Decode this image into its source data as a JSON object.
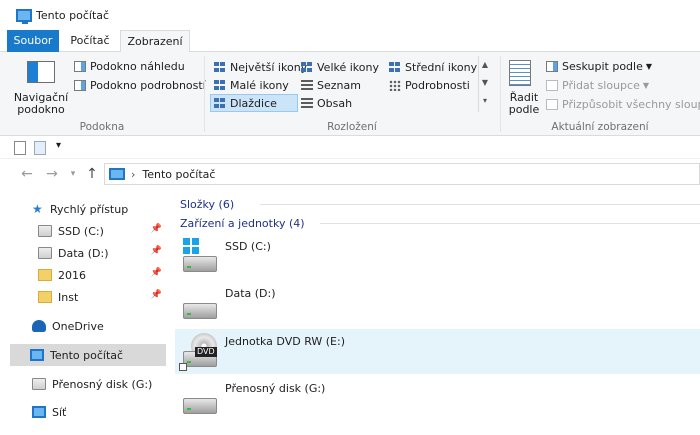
{
  "window": {
    "title": "Tento počítač"
  },
  "tabs": {
    "file": "Soubor",
    "computer": "Počítač",
    "view": "Zobrazení"
  },
  "ribbon": {
    "panes": {
      "nav_pane": "Navigační podokno",
      "preview_pane": "Podokno náhledu",
      "details_pane": "Podokno podrobností",
      "group_label": "Podokna"
    },
    "layout": {
      "extra_large": "Největší ikony",
      "large": "Velké ikony",
      "medium": "Střední ikony",
      "small": "Malé ikony",
      "list": "Seznam",
      "details": "Podrobnosti",
      "tiles": "Dlaždice",
      "content": "Obsah",
      "group_label": "Rozložení"
    },
    "current_view": {
      "sort_by": "Řadit podle",
      "group_by": "Seskupit podle",
      "add_columns": "Přidat sloupce",
      "size_columns": "Přizpůsobit všechny sloupce",
      "group_label": "Aktuální zobrazení"
    }
  },
  "address": {
    "separator": "›",
    "location": "Tento počítač"
  },
  "nav_pane": {
    "quick_access": "Rychlý přístup",
    "pinned": [
      "SSD (C:)",
      "Data (D:)",
      "2016",
      "Inst"
    ],
    "onedrive": "OneDrive",
    "this_pc": "Tento počítač",
    "removable": "Přenosný disk (G:)",
    "network": "Síť"
  },
  "content": {
    "folders_header": "Složky (6)",
    "devices_header": "Zařízení a jednotky (4)",
    "drives": [
      "SSD (C:)",
      "Data (D:)",
      "Jednotka DVD RW (E:)",
      "Přenosný disk (G:)"
    ],
    "dvd_badge": "DVD"
  },
  "colors": {
    "accent": "#1979ca",
    "selection": "#cce4f7",
    "header_text": "#1e3287"
  }
}
